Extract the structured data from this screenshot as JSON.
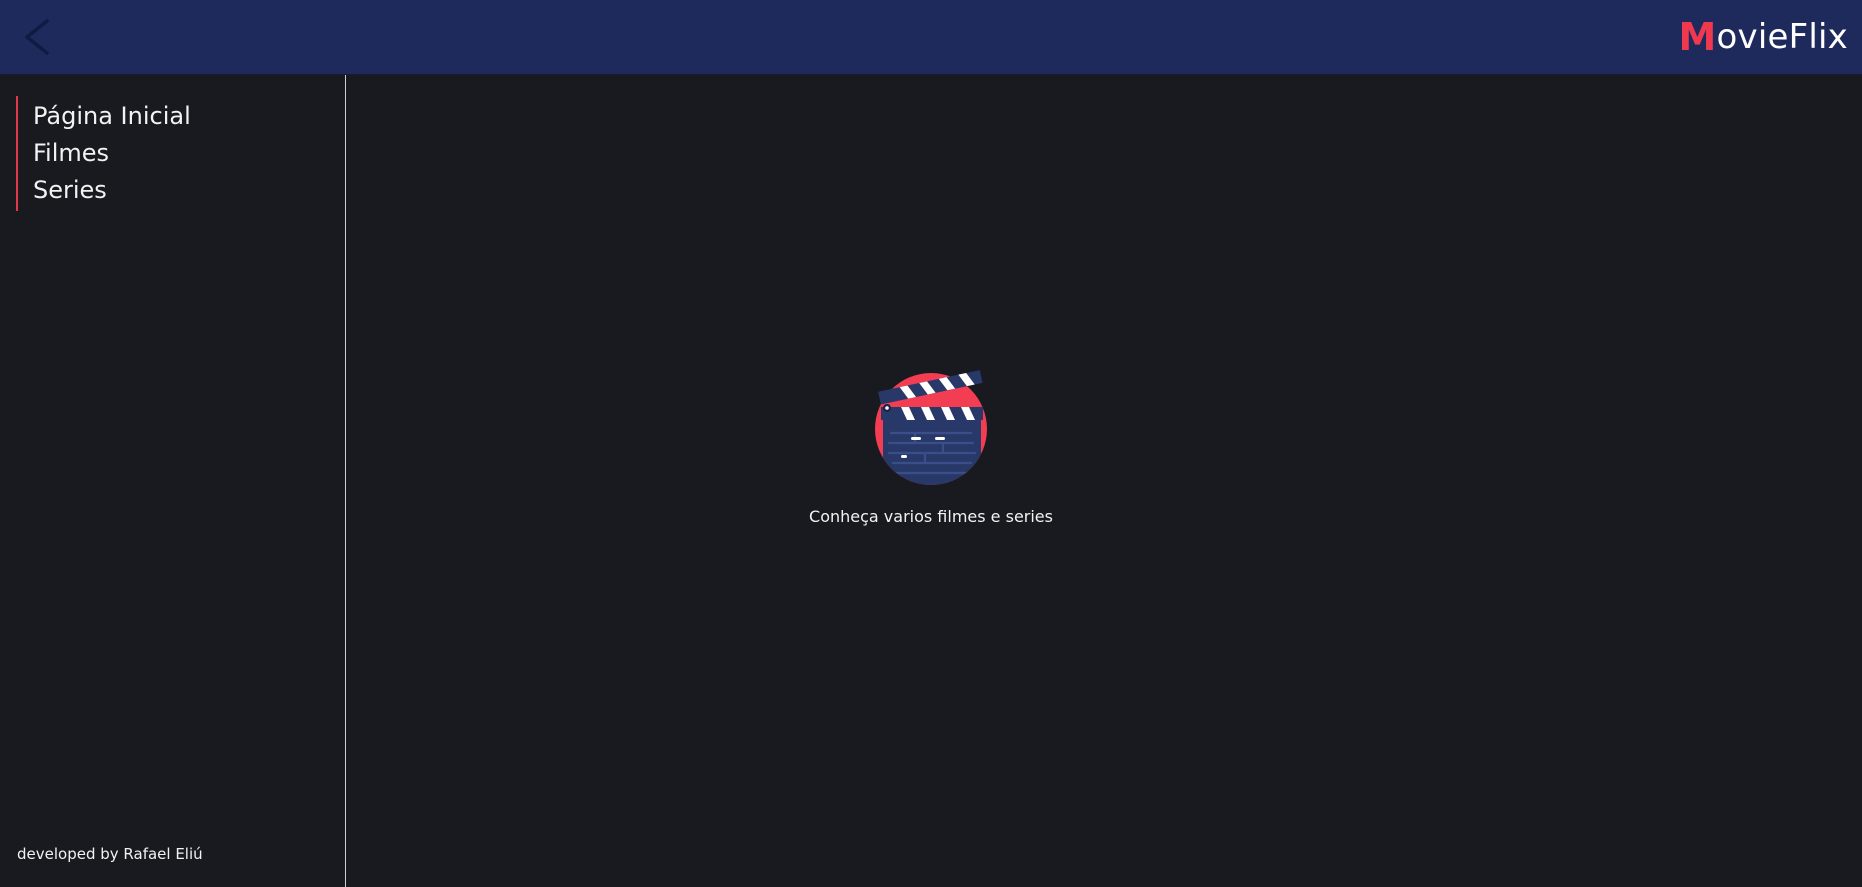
{
  "header": {
    "back_icon": "chevron-left-icon",
    "logo_initial": "M",
    "logo_rest": "ovieFlix",
    "colors": {
      "background": "#1f2a5c",
      "accent": "#f0384f"
    }
  },
  "sidebar": {
    "items": [
      {
        "label": "Página Inicial"
      },
      {
        "label": "Filmes"
      },
      {
        "label": "Series"
      }
    ],
    "footer": "developed by Rafael Eliú",
    "colors": {
      "indicator": "#e0394c"
    }
  },
  "main": {
    "illustration_icon": "clapperboard-icon",
    "caption": "Conheça varios filmes e series"
  }
}
